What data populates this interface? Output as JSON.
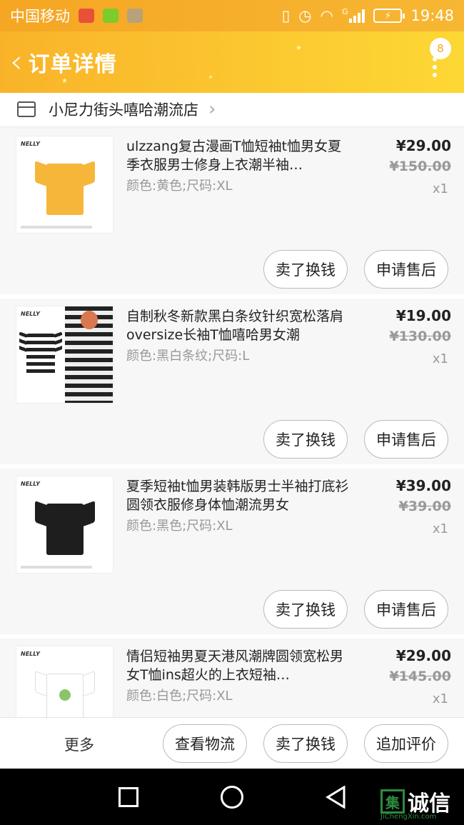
{
  "status_bar": {
    "carrier": "中国移动",
    "signal_label": "G",
    "time": "19:48"
  },
  "header": {
    "back_label": "‹",
    "title": "订单详情",
    "badge_count": "8"
  },
  "shop": {
    "name": "小尼力街头嘻哈潮流店",
    "arrow": "›"
  },
  "products": [
    {
      "title": "ulzzang复古漫画T恤短袖t恤男女夏季衣服男士修身上衣潮半袖…",
      "spec": "颜色:黄色;尺码:XL",
      "price": "¥29.00",
      "original_price": "¥150.00",
      "quantity": "x1",
      "brand": "NELLY",
      "shirt_color": "#f6b63a",
      "sell_label": "卖了换钱",
      "after_sale_label": "申请售后"
    },
    {
      "title": "自制秋冬新款黑白条纹针织宽松落肩oversize长袖T恤嘻哈男女潮",
      "spec": "颜色:黑白条纹;尺码:L",
      "price": "¥19.00",
      "original_price": "¥130.00",
      "quantity": "x1",
      "brand": "NELLY",
      "shirt_color": "stripe",
      "sell_label": "卖了换钱",
      "after_sale_label": "申请售后"
    },
    {
      "title": "夏季短袖t恤男装韩版男士半袖打底衫圆领衣服修身体恤潮流男女",
      "spec": "颜色:黑色;尺码:XL",
      "price": "¥39.00",
      "original_price": "¥39.00",
      "quantity": "x1",
      "brand": "NELLY",
      "shirt_color": "#1e1e1e",
      "sell_label": "卖了换钱",
      "after_sale_label": "申请售后"
    },
    {
      "title": "情侣短袖男夏天港风潮牌圆领宽松男女T恤ins超火的上衣短袖…",
      "spec": "颜色:白色;尺码:XL",
      "price": "¥29.00",
      "original_price": "¥145.00",
      "quantity": "x1",
      "brand": "NELLY",
      "shirt_color": "#ffffff"
    }
  ],
  "bottom_bar": {
    "more_label": "更多",
    "logistics_label": "查看物流",
    "sell_label": "卖了换钱",
    "review_label": "追加评价"
  },
  "watermark": {
    "mark": "集",
    "text": "诚信",
    "url": "JiChengXin.com"
  }
}
